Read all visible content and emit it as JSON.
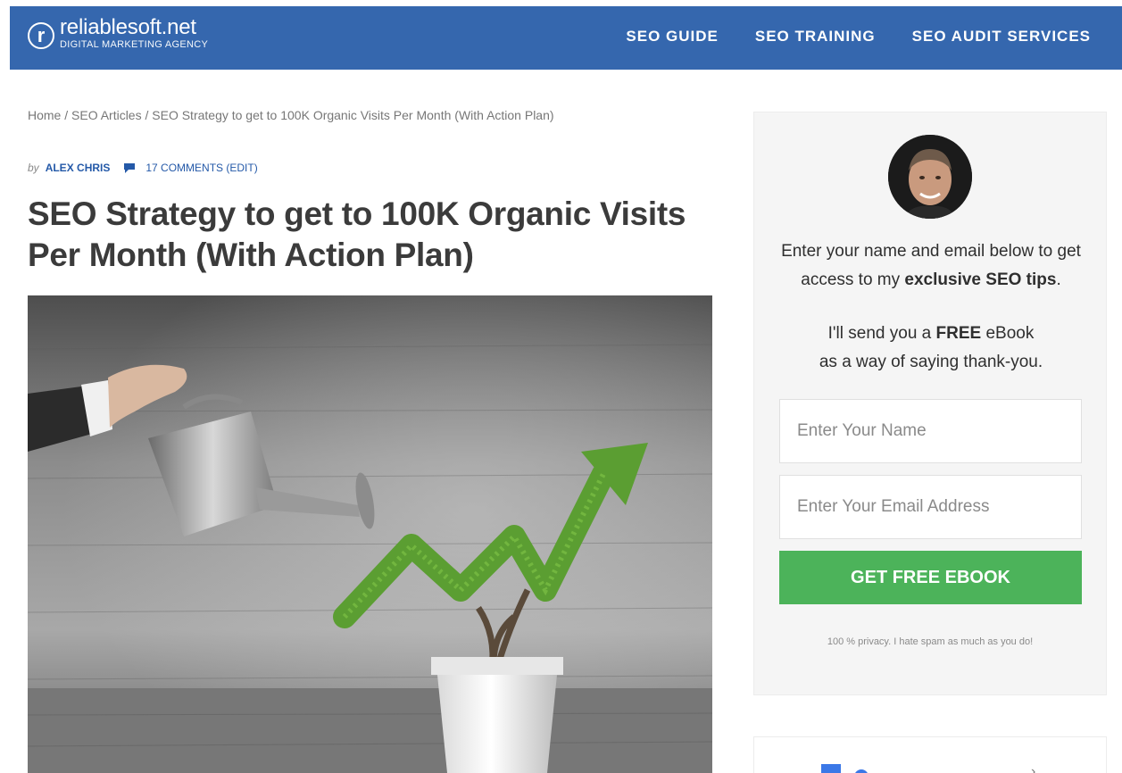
{
  "header": {
    "logo_mark": "r",
    "logo_name": "reliablesoft.net",
    "logo_tagline": "DIGITAL MARKETING AGENCY",
    "nav": [
      "SEO GUIDE",
      "SEO TRAINING",
      "SEO AUDIT SERVICES"
    ],
    "brand_color": "#3567ae"
  },
  "article": {
    "breadcrumb": "Home / SEO Articles / SEO Strategy to get to 100K Organic Visits Per Month (With Action Plan)",
    "by": "by",
    "author": "ALEX CHRIS",
    "comments": "17 COMMENTS (EDIT)",
    "title": "SEO Strategy to get to 100K Organic Visits Per Month (With Action Plan)"
  },
  "optin": {
    "lead_part1": "Enter your name and email below to get access to my ",
    "lead_bold": "exclusive SEO tips",
    "lead_end": ".",
    "offer_part1": "I'll send you a ",
    "offer_bold": "FREE",
    "offer_part2": " eBook",
    "offer_line2": "as a way of saying thank-you.",
    "name_placeholder": "Enter Your Name",
    "email_placeholder": "Enter Your Email Address",
    "button_label": "GET FREE EBOOK",
    "privacy": "100 % privacy. I hate spam as much as you do!",
    "button_color": "#4cb35a"
  }
}
